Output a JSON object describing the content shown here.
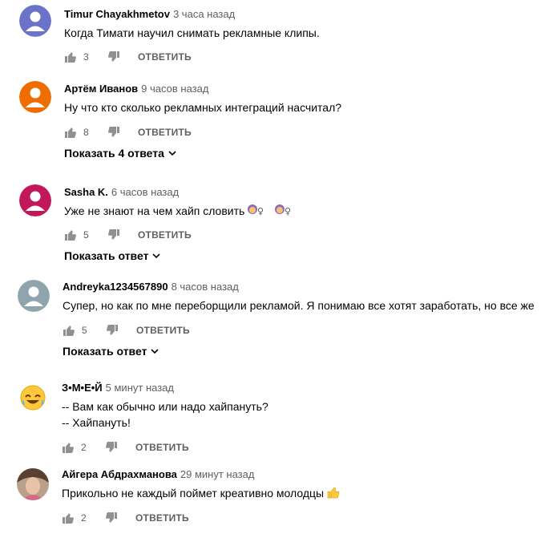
{
  "actions": {
    "reply_label": "ОТВЕТИТЬ"
  },
  "comments": [
    {
      "author": "Timur Chayakhmetov",
      "time": "3 часа назад",
      "lines": [
        "Когда Тимати научил снимать рекламные клипы."
      ],
      "likes": "3",
      "replies_label": "",
      "avatar_color": "#6a73c7"
    },
    {
      "author": "Артём Иванов",
      "time": "9 часов назад",
      "lines": [
        "Ну что кто сколько рекламных интеграций насчитал?"
      ],
      "likes": "8",
      "replies_label": "Показать 4 ответа",
      "avatar_color": "#ef6c00"
    },
    {
      "author": "Sasha K.",
      "time": "6 часов назад",
      "lines": [
        "Уже не знают на чем хайп словить"
      ],
      "likes": "5",
      "replies_label": "Показать ответ",
      "avatar_color": "#c2185b"
    },
    {
      "author": "Andreyka1234567890",
      "time": "8 часов назад",
      "lines": [
        "Супер, но как по мне переборщили рекламой. Я понимаю все хотят заработать, но все же"
      ],
      "likes": "5",
      "replies_label": "Показать ответ",
      "avatar_color": "#90a4ae"
    },
    {
      "author": "З•М•Е•Й",
      "time": "5 минут назад",
      "lines": [
        "-- Вам как обычно или надо хайпануть?",
        "-- Хайпануть!"
      ],
      "likes": "2",
      "replies_label": "",
      "avatar_color": "#ffc83d"
    },
    {
      "author": "Айгера Абдрахманова",
      "time": "29 минут назад",
      "lines": [
        "Прикольно не каждый поймет креативно молодцы"
      ],
      "likes": "2",
      "replies_label": "",
      "avatar_color": "#b8a08a"
    }
  ]
}
